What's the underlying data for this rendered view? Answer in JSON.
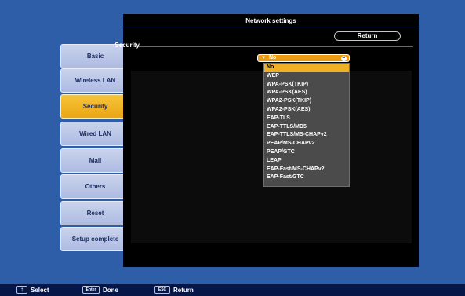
{
  "panel": {
    "title": "Network settings",
    "return_label": "Return"
  },
  "sidebar": {
    "items": [
      {
        "label": "Basic"
      },
      {
        "label": "Wireless LAN"
      },
      {
        "label": "Security"
      },
      {
        "label": "Wired LAN"
      },
      {
        "label": "Mail"
      },
      {
        "label": "Others"
      },
      {
        "label": "Reset"
      },
      {
        "label": "Setup complete"
      }
    ],
    "active_index": 2
  },
  "security": {
    "label": "Security",
    "value": "No",
    "options": [
      "No",
      "WEP",
      "WPA-PSK(TKIP)",
      "WPA-PSK(AES)",
      "WPA2-PSK(TKIP)",
      "WPA2-PSK(AES)",
      "EAP-TLS",
      "EAP-TTLS/MD5",
      "EAP-TTLS/MS-CHAPv2",
      "PEAP/MS-CHAPv2",
      "PEAP/GTC",
      "LEAP",
      "EAP-Fast/MS-CHAPv2",
      "EAP-Fast/GTC"
    ]
  },
  "footer": {
    "select_label": "Select",
    "done_key": "Enter",
    "done_label": "Done",
    "return_key": "ESC",
    "return_label": "Return"
  },
  "colors": {
    "background": "#2f5ea8",
    "accent": "#f0b024",
    "panel": "#000000",
    "bottombar": "#061646"
  },
  "icons": {
    "select_arrow": "triangle-down-icon",
    "enter": "enter-icon",
    "updown": "up-down-arrow-icon"
  }
}
